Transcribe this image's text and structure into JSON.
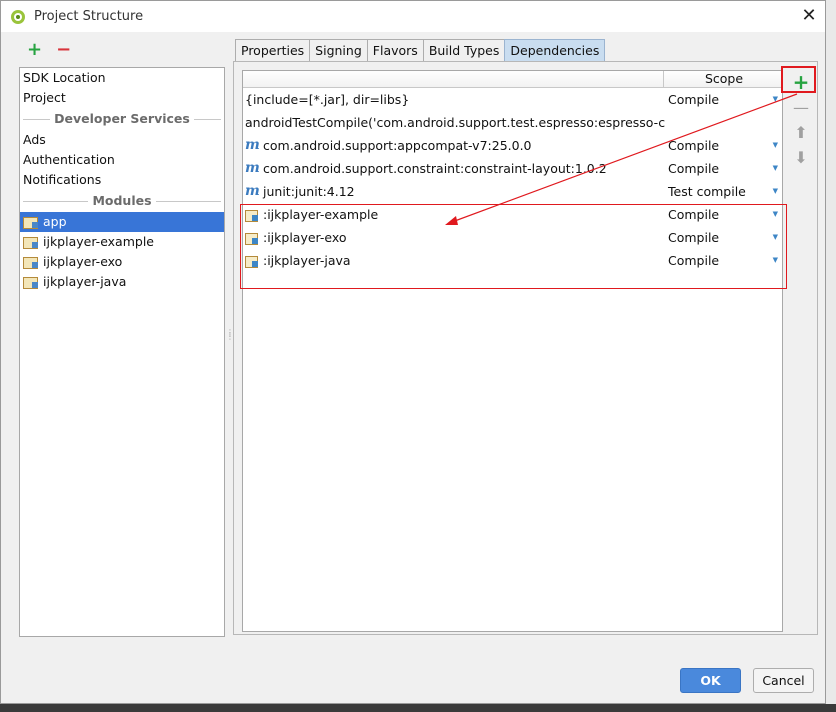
{
  "window": {
    "title": "Project Structure",
    "close_glyph": "✕"
  },
  "left_toolbar": {
    "add_glyph": "+",
    "remove_glyph": "−"
  },
  "left_list": {
    "top_items": [
      "SDK Location",
      "Project"
    ],
    "developer_services": {
      "header": "Developer Services",
      "items": [
        "Ads",
        "Authentication",
        "Notifications"
      ]
    },
    "modules": {
      "header": "Modules",
      "items": [
        "app",
        "ijkplayer-example",
        "ijkplayer-exo",
        "ijkplayer-java"
      ],
      "selected": "app"
    }
  },
  "tabs": {
    "items": [
      "Properties",
      "Signing",
      "Flavors",
      "Build Types",
      "Dependencies"
    ],
    "active": "Dependencies"
  },
  "dependencies": {
    "scope_header": "Scope",
    "rows": [
      {
        "icon": "none",
        "name": "{include=[*.jar], dir=libs}",
        "scope": "Compile"
      },
      {
        "icon": "none",
        "name": "androidTestCompile('com.android.support.test.espresso:espresso-core:",
        "scope": ""
      },
      {
        "icon": "maven-icon",
        "name": "com.android.support:appcompat-v7:25.0.0",
        "scope": "Compile"
      },
      {
        "icon": "maven-icon",
        "name": "com.android.support.constraint:constraint-layout:1.0.2",
        "scope": "Compile"
      },
      {
        "icon": "maven-icon",
        "name": "junit:junit:4.12",
        "scope": "Test compile"
      },
      {
        "icon": "module-icon",
        "name": ":ijkplayer-example",
        "scope": "Compile"
      },
      {
        "icon": "module-icon",
        "name": ":ijkplayer-exo",
        "scope": "Compile"
      },
      {
        "icon": "module-icon",
        "name": ":ijkplayer-java",
        "scope": "Compile"
      }
    ],
    "maven_glyph": "m",
    "dropdown_glyph": "▼"
  },
  "side_tools": {
    "add": "+",
    "remove": "—",
    "up": "⬆",
    "down": "⬇"
  },
  "buttons": {
    "ok": "OK",
    "cancel": "Cancel"
  },
  "colors": {
    "accent": "#3875d7",
    "ok_button": "#4a89dc",
    "annotation": "#e0191e",
    "add_green": "#27a341",
    "remove_red": "#d8333a"
  }
}
